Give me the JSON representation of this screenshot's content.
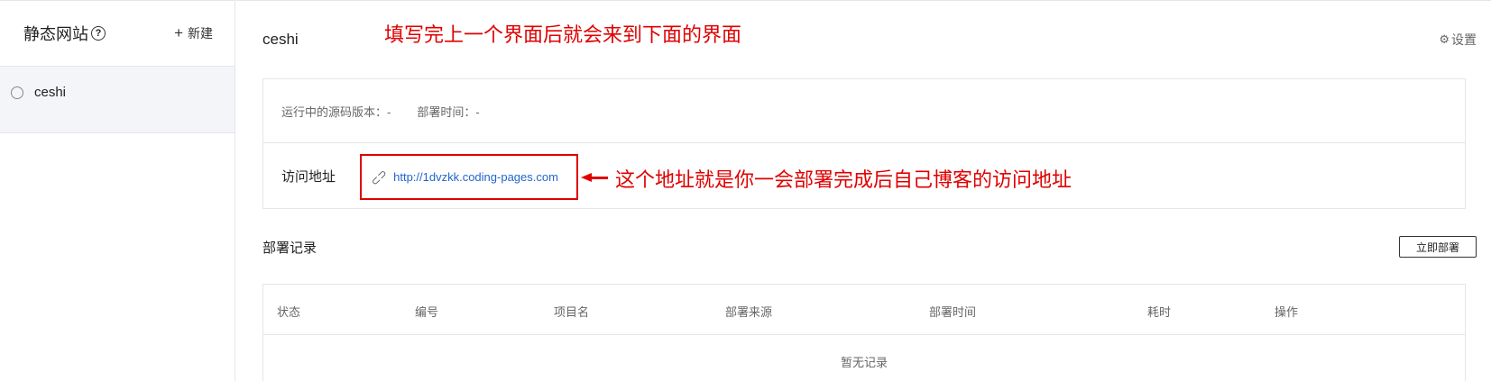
{
  "sidebar": {
    "title": "静态网站",
    "new_label": "新建",
    "items": [
      {
        "label": "ceshi"
      }
    ]
  },
  "header": {
    "title": "ceshi",
    "settings_label": "设置",
    "annotation": "填写完上一个界面后就会来到下面的界面"
  },
  "info": {
    "source_version": "运行中的源码版本：-",
    "deploy_time": "部署时间：-",
    "access_label": "访问地址",
    "url": "http://1dvzkk.coding-pages.com",
    "annotation": "这个地址就是你一会部署完成后自己博客的访问地址"
  },
  "records": {
    "title": "部署记录",
    "deploy_button": "立即部署",
    "columns": [
      "状态",
      "编号",
      "项目名",
      "部署来源",
      "部署时间",
      "耗时",
      "操作"
    ],
    "empty_text": "暂无记录"
  },
  "colors": {
    "annotation": "#e00000",
    "link": "#2266cc",
    "selected_bg": "#f4f5f8"
  }
}
